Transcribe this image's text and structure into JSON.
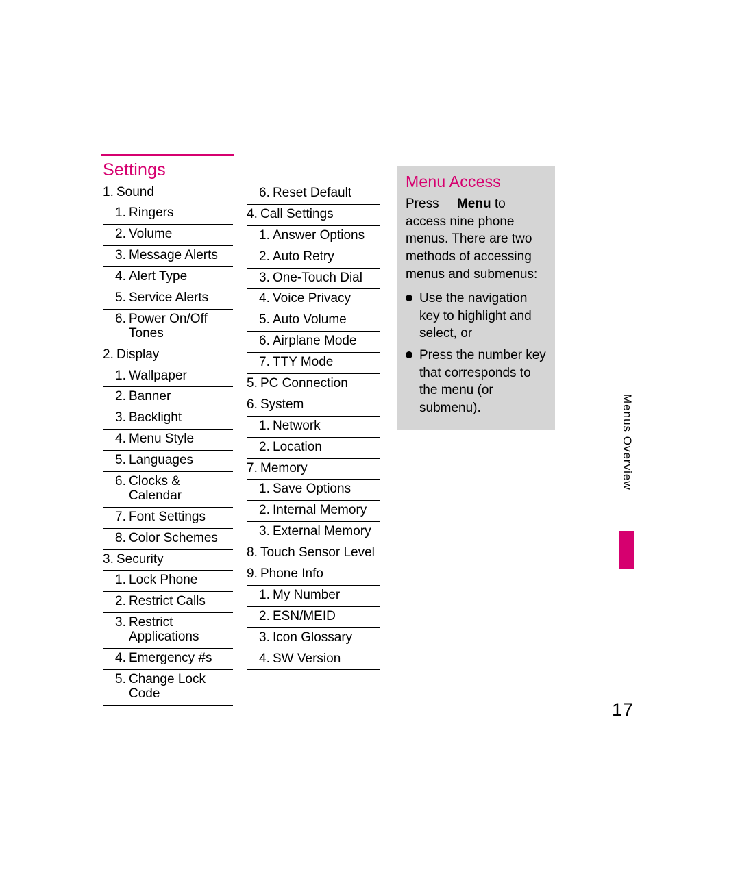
{
  "headings": {
    "settings": "Settings",
    "menu_access": "Menu Access"
  },
  "col1": [
    {
      "lvl": 1,
      "num": "1.",
      "txt": "Sound"
    },
    {
      "lvl": 2,
      "num": "1.",
      "txt": "Ringers"
    },
    {
      "lvl": 2,
      "num": "2.",
      "txt": "Volume"
    },
    {
      "lvl": 2,
      "num": "3.",
      "txt": "Message Alerts"
    },
    {
      "lvl": 2,
      "num": "4.",
      "txt": "Alert Type"
    },
    {
      "lvl": 2,
      "num": "5.",
      "txt": "Service Alerts"
    },
    {
      "lvl": 2,
      "num": "6.",
      "txt": "Power On/Off Tones"
    },
    {
      "lvl": 1,
      "num": "2.",
      "txt": "Display"
    },
    {
      "lvl": 2,
      "num": "1.",
      "txt": "Wallpaper"
    },
    {
      "lvl": 2,
      "num": "2.",
      "txt": "Banner"
    },
    {
      "lvl": 2,
      "num": "3.",
      "txt": "Backlight"
    },
    {
      "lvl": 2,
      "num": "4.",
      "txt": "Menu Style"
    },
    {
      "lvl": 2,
      "num": "5.",
      "txt": "Languages"
    },
    {
      "lvl": 2,
      "num": "6.",
      "txt": "Clocks & Calendar"
    },
    {
      "lvl": 2,
      "num": "7.",
      "txt": "Font Settings"
    },
    {
      "lvl": 2,
      "num": "8.",
      "txt": "Color Schemes"
    },
    {
      "lvl": 1,
      "num": "3.",
      "txt": "Security"
    },
    {
      "lvl": 2,
      "num": "1.",
      "txt": "Lock Phone"
    },
    {
      "lvl": 2,
      "num": "2.",
      "txt": "Restrict Calls"
    },
    {
      "lvl": 2,
      "num": "3.",
      "txt": "Restrict Applications"
    },
    {
      "lvl": 2,
      "num": "4.",
      "txt": "Emergency #s"
    },
    {
      "lvl": 2,
      "num": "5.",
      "txt": "Change Lock Code"
    }
  ],
  "col2": [
    {
      "lvl": 2,
      "num": "6.",
      "txt": "Reset Default"
    },
    {
      "lvl": 1,
      "num": "4.",
      "txt": "Call Settings"
    },
    {
      "lvl": 2,
      "num": "1.",
      "txt": "Answer Options"
    },
    {
      "lvl": 2,
      "num": "2.",
      "txt": "Auto Retry"
    },
    {
      "lvl": 2,
      "num": "3.",
      "txt": "One-Touch Dial"
    },
    {
      "lvl": 2,
      "num": "4.",
      "txt": "Voice Privacy"
    },
    {
      "lvl": 2,
      "num": "5.",
      "txt": "Auto Volume"
    },
    {
      "lvl": 2,
      "num": "6.",
      "txt": "Airplane Mode"
    },
    {
      "lvl": 2,
      "num": "7.",
      "txt": "TTY Mode"
    },
    {
      "lvl": 1,
      "num": "5.",
      "txt": "PC Connection"
    },
    {
      "lvl": 1,
      "num": "6.",
      "txt": "System"
    },
    {
      "lvl": 2,
      "num": "1.",
      "txt": "Network"
    },
    {
      "lvl": 2,
      "num": "2.",
      "txt": "Location"
    },
    {
      "lvl": 1,
      "num": "7.",
      "txt": "Memory"
    },
    {
      "lvl": 2,
      "num": "1.",
      "txt": "Save Options"
    },
    {
      "lvl": 2,
      "num": "2.",
      "txt": "Internal Memory"
    },
    {
      "lvl": 2,
      "num": "3.",
      "txt": "External Memory"
    },
    {
      "lvl": 1,
      "num": "8.",
      "txt": "Touch Sensor Level"
    },
    {
      "lvl": 1,
      "num": "9.",
      "txt": "Phone Info"
    },
    {
      "lvl": 2,
      "num": "1.",
      "txt": "My Number"
    },
    {
      "lvl": 2,
      "num": "2.",
      "txt": "ESN/MEID"
    },
    {
      "lvl": 2,
      "num": "3.",
      "txt": "Icon Glossary"
    },
    {
      "lvl": 2,
      "num": "4.",
      "txt": "SW Version"
    }
  ],
  "menu_access": {
    "press": "Press",
    "menu_word": "Menu",
    "rest": " to access nine phone menus. There are two methods of accessing menus and submenus:",
    "bullets": [
      "Use the navigation key to highlight and select, or",
      "Press the number key that corresponds to the menu (or submenu)."
    ]
  },
  "section_label": "Menus Overview",
  "page_number": "17"
}
